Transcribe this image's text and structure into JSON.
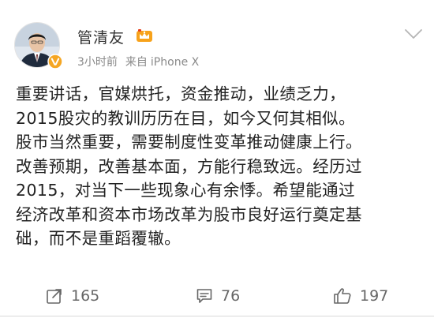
{
  "post": {
    "username": "管清友",
    "time": "3小时前",
    "source_label": "来自",
    "device": "iPhone X",
    "lines": [
      "重要讲话，官媒烘托，资金推动，业绩乏力，",
      "2015股灾的教训历历在目，如今又何其相似。",
      "股市当然重要，需要制度性变革推动健康上行。",
      "改善预期，改善基本面，方能行稳致远。经历过",
      "2015，对当下一些现象心有余悸。希望能通过",
      "经济改革和资本市场改革为股市良好运行奠定基",
      "础，而不是重蹈覆辙。"
    ]
  },
  "actions": {
    "repost_count": "165",
    "comment_count": "76",
    "like_count": "197"
  },
  "colors": {
    "verified": "#f5a623",
    "text": "#222222",
    "meta": "#8a8a8a"
  },
  "icons": {
    "verified": "verified-v-icon",
    "member": "crown-icon",
    "menu": "chevron-down-icon",
    "repost": "repost-icon",
    "comment": "comment-icon",
    "like": "thumbs-up-icon"
  }
}
